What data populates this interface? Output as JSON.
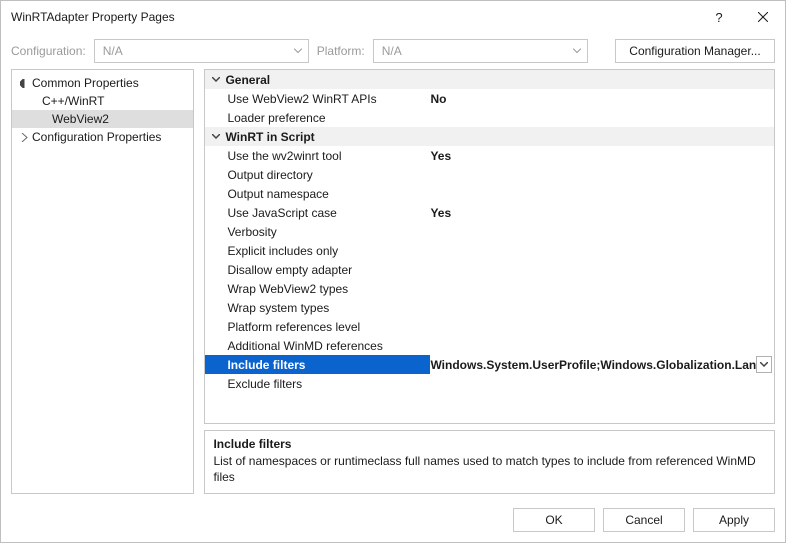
{
  "titlebar": {
    "title": "WinRTAdapter Property Pages",
    "help": "?",
    "close": "✕"
  },
  "configrow": {
    "config_label": "Configuration:",
    "config_value": "N/A",
    "platform_label": "Platform:",
    "platform_value": "N/A",
    "cfgmgr_label": "Configuration Manager..."
  },
  "tree": {
    "items": [
      {
        "label": "Common Properties"
      },
      {
        "label": "C++/WinRT"
      },
      {
        "label": "WebView2"
      },
      {
        "label": "Configuration Properties"
      }
    ]
  },
  "grid": {
    "cat_general": "General",
    "cat_winrt": "WinRT in Script",
    "props": {
      "use_wv2_apis": {
        "name": "Use WebView2 WinRT APIs",
        "value": "No"
      },
      "loader_pref": {
        "name": "Loader preference",
        "value": ""
      },
      "use_wv2winrt": {
        "name": "Use the wv2winrt tool",
        "value": "Yes"
      },
      "output_dir": {
        "name": "Output directory",
        "value": ""
      },
      "output_ns": {
        "name": "Output namespace",
        "value": ""
      },
      "js_case": {
        "name": "Use JavaScript case",
        "value": "Yes"
      },
      "verbosity": {
        "name": "Verbosity",
        "value": ""
      },
      "explicit_inc": {
        "name": "Explicit includes only",
        "value": ""
      },
      "disallow_empty": {
        "name": "Disallow empty adapter",
        "value": ""
      },
      "wrap_wv2": {
        "name": "Wrap WebView2 types",
        "value": ""
      },
      "wrap_sys": {
        "name": "Wrap system types",
        "value": ""
      },
      "plat_refs": {
        "name": "Platform references level",
        "value": ""
      },
      "add_winmd": {
        "name": "Additional WinMD references",
        "value": ""
      },
      "include_filters": {
        "name": "Include filters",
        "value": "Windows.System.UserProfile;Windows.Globalization.Lan"
      },
      "exclude_filters": {
        "name": "Exclude filters",
        "value": ""
      }
    }
  },
  "desc": {
    "title": "Include filters",
    "body": "List of namespaces or runtimeclass full names used to match types to include from referenced WinMD files"
  },
  "footer": {
    "ok": "OK",
    "cancel": "Cancel",
    "apply": "Apply"
  }
}
